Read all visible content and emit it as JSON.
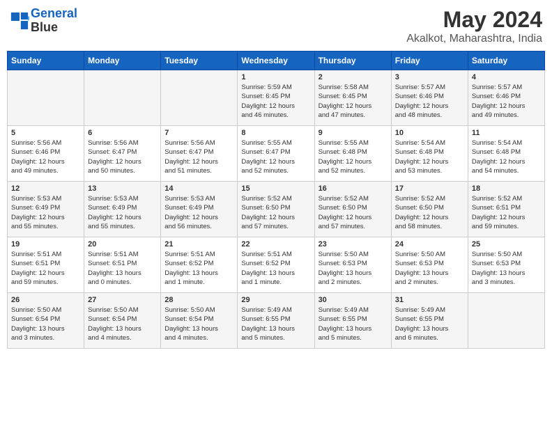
{
  "header": {
    "logo_line1": "General",
    "logo_line2": "Blue",
    "main_title": "May 2024",
    "subtitle": "Akalkot, Maharashtra, India"
  },
  "days_of_week": [
    "Sunday",
    "Monday",
    "Tuesday",
    "Wednesday",
    "Thursday",
    "Friday",
    "Saturday"
  ],
  "weeks": [
    [
      {
        "day": "",
        "info": ""
      },
      {
        "day": "",
        "info": ""
      },
      {
        "day": "",
        "info": ""
      },
      {
        "day": "1",
        "info": "Sunrise: 5:59 AM\nSunset: 6:45 PM\nDaylight: 12 hours\nand 46 minutes."
      },
      {
        "day": "2",
        "info": "Sunrise: 5:58 AM\nSunset: 6:45 PM\nDaylight: 12 hours\nand 47 minutes."
      },
      {
        "day": "3",
        "info": "Sunrise: 5:57 AM\nSunset: 6:46 PM\nDaylight: 12 hours\nand 48 minutes."
      },
      {
        "day": "4",
        "info": "Sunrise: 5:57 AM\nSunset: 6:46 PM\nDaylight: 12 hours\nand 49 minutes."
      }
    ],
    [
      {
        "day": "5",
        "info": "Sunrise: 5:56 AM\nSunset: 6:46 PM\nDaylight: 12 hours\nand 49 minutes."
      },
      {
        "day": "6",
        "info": "Sunrise: 5:56 AM\nSunset: 6:47 PM\nDaylight: 12 hours\nand 50 minutes."
      },
      {
        "day": "7",
        "info": "Sunrise: 5:56 AM\nSunset: 6:47 PM\nDaylight: 12 hours\nand 51 minutes."
      },
      {
        "day": "8",
        "info": "Sunrise: 5:55 AM\nSunset: 6:47 PM\nDaylight: 12 hours\nand 52 minutes."
      },
      {
        "day": "9",
        "info": "Sunrise: 5:55 AM\nSunset: 6:48 PM\nDaylight: 12 hours\nand 52 minutes."
      },
      {
        "day": "10",
        "info": "Sunrise: 5:54 AM\nSunset: 6:48 PM\nDaylight: 12 hours\nand 53 minutes."
      },
      {
        "day": "11",
        "info": "Sunrise: 5:54 AM\nSunset: 6:48 PM\nDaylight: 12 hours\nand 54 minutes."
      }
    ],
    [
      {
        "day": "12",
        "info": "Sunrise: 5:53 AM\nSunset: 6:49 PM\nDaylight: 12 hours\nand 55 minutes."
      },
      {
        "day": "13",
        "info": "Sunrise: 5:53 AM\nSunset: 6:49 PM\nDaylight: 12 hours\nand 55 minutes."
      },
      {
        "day": "14",
        "info": "Sunrise: 5:53 AM\nSunset: 6:49 PM\nDaylight: 12 hours\nand 56 minutes."
      },
      {
        "day": "15",
        "info": "Sunrise: 5:52 AM\nSunset: 6:50 PM\nDaylight: 12 hours\nand 57 minutes."
      },
      {
        "day": "16",
        "info": "Sunrise: 5:52 AM\nSunset: 6:50 PM\nDaylight: 12 hours\nand 57 minutes."
      },
      {
        "day": "17",
        "info": "Sunrise: 5:52 AM\nSunset: 6:50 PM\nDaylight: 12 hours\nand 58 minutes."
      },
      {
        "day": "18",
        "info": "Sunrise: 5:52 AM\nSunset: 6:51 PM\nDaylight: 12 hours\nand 59 minutes."
      }
    ],
    [
      {
        "day": "19",
        "info": "Sunrise: 5:51 AM\nSunset: 6:51 PM\nDaylight: 12 hours\nand 59 minutes."
      },
      {
        "day": "20",
        "info": "Sunrise: 5:51 AM\nSunset: 6:51 PM\nDaylight: 13 hours\nand 0 minutes."
      },
      {
        "day": "21",
        "info": "Sunrise: 5:51 AM\nSunset: 6:52 PM\nDaylight: 13 hours\nand 1 minute."
      },
      {
        "day": "22",
        "info": "Sunrise: 5:51 AM\nSunset: 6:52 PM\nDaylight: 13 hours\nand 1 minute."
      },
      {
        "day": "23",
        "info": "Sunrise: 5:50 AM\nSunset: 6:53 PM\nDaylight: 13 hours\nand 2 minutes."
      },
      {
        "day": "24",
        "info": "Sunrise: 5:50 AM\nSunset: 6:53 PM\nDaylight: 13 hours\nand 2 minutes."
      },
      {
        "day": "25",
        "info": "Sunrise: 5:50 AM\nSunset: 6:53 PM\nDaylight: 13 hours\nand 3 minutes."
      }
    ],
    [
      {
        "day": "26",
        "info": "Sunrise: 5:50 AM\nSunset: 6:54 PM\nDaylight: 13 hours\nand 3 minutes."
      },
      {
        "day": "27",
        "info": "Sunrise: 5:50 AM\nSunset: 6:54 PM\nDaylight: 13 hours\nand 4 minutes."
      },
      {
        "day": "28",
        "info": "Sunrise: 5:50 AM\nSunset: 6:54 PM\nDaylight: 13 hours\nand 4 minutes."
      },
      {
        "day": "29",
        "info": "Sunrise: 5:49 AM\nSunset: 6:55 PM\nDaylight: 13 hours\nand 5 minutes."
      },
      {
        "day": "30",
        "info": "Sunrise: 5:49 AM\nSunset: 6:55 PM\nDaylight: 13 hours\nand 5 minutes."
      },
      {
        "day": "31",
        "info": "Sunrise: 5:49 AM\nSunset: 6:55 PM\nDaylight: 13 hours\nand 6 minutes."
      },
      {
        "day": "",
        "info": ""
      }
    ]
  ]
}
